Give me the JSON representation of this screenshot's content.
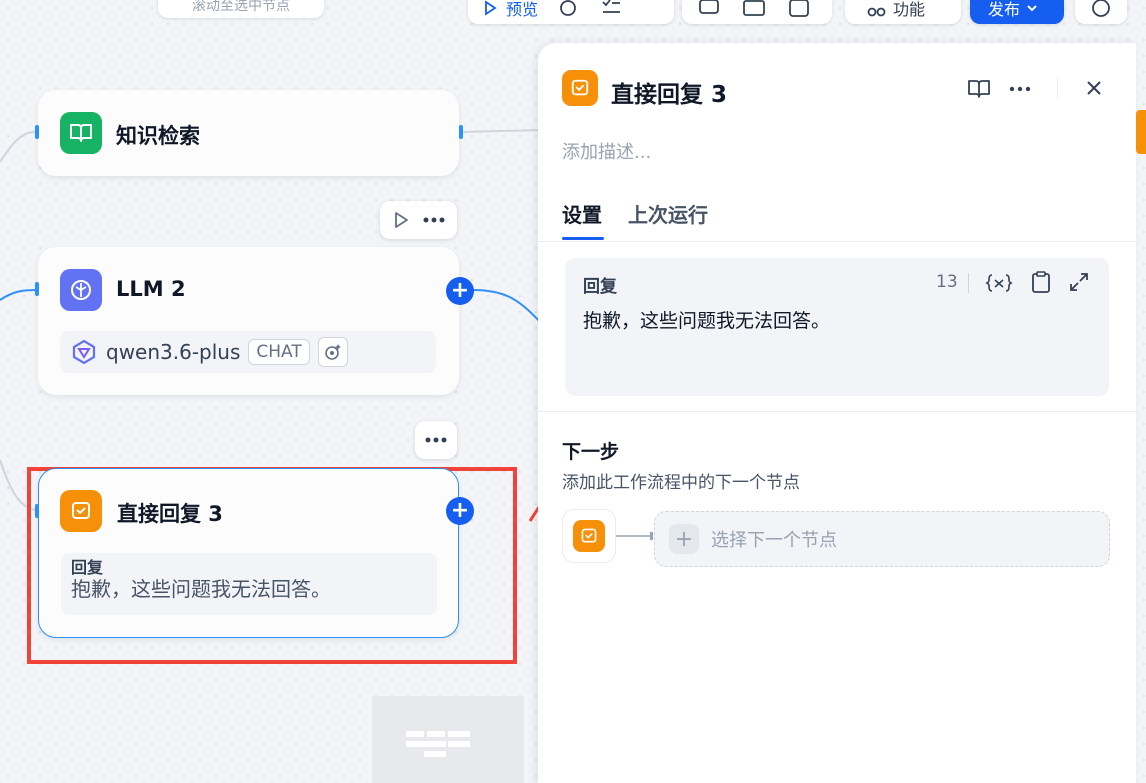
{
  "toolbar": {
    "hint": "滚动至选中节点",
    "preview_label": "预览",
    "feature_label": "功能",
    "publish_label": "发布"
  },
  "canvas": {
    "knowledge_node": {
      "title": "知识检索"
    },
    "llm_node": {
      "title": "LLM 2",
      "model_name": "qwen3.6-plus",
      "model_tag": "CHAT"
    },
    "reply_node": {
      "title": "直接回复 3",
      "reply_label": "回复",
      "reply_text": "抱歉，这些问题我无法回答。"
    }
  },
  "panel": {
    "title": "直接回复 3",
    "description_placeholder": "添加描述...",
    "tabs": [
      {
        "label": "设置",
        "active": true
      },
      {
        "label": "上次运行",
        "active": false
      }
    ],
    "field": {
      "label": "回复",
      "char_count": "13",
      "value": "抱歉，这些问题我无法回答。"
    },
    "next_step": {
      "title": "下一步",
      "description": "添加此工作流程中的下一个节点",
      "select_placeholder": "选择下一个节点"
    }
  },
  "colors": {
    "accent": "#155eef",
    "annotation_red": "#f04438",
    "knowledge_icon": "#16b364",
    "llm_icon": "#6172f3",
    "reply_icon": "#f79009"
  },
  "icons": [
    "play-icon",
    "book-icon",
    "llm-brain-icon",
    "qwen-logo-icon",
    "vision-icon",
    "more-icon",
    "plus-icon",
    "reply-icon",
    "close-icon",
    "variable-icon",
    "copy-icon",
    "expand-icon",
    "history-icon",
    "chevron-down-icon"
  ]
}
